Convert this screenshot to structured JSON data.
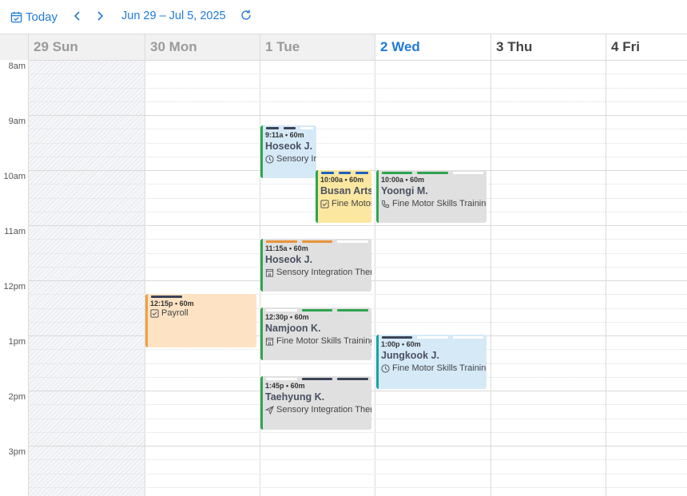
{
  "toolbar": {
    "today_label": "Today",
    "range_label": "Jun 29 – Jul 5, 2025",
    "icons": {
      "today": "calendar-check-icon",
      "prev": "chevron-left-icon",
      "next": "chevron-right-icon",
      "refresh": "refresh-icon"
    },
    "accent": "#1f7ad6"
  },
  "days": [
    {
      "num": "29",
      "name": "Sun",
      "state": "past"
    },
    {
      "num": "30",
      "name": "Mon",
      "state": "past"
    },
    {
      "num": "1",
      "name": "Tue",
      "state": "past"
    },
    {
      "num": "2",
      "name": "Wed",
      "state": "today"
    },
    {
      "num": "3",
      "name": "Thu",
      "state": "future"
    },
    {
      "num": "4",
      "name": "Fri",
      "state": "future"
    }
  ],
  "hours": [
    "8am",
    "9am",
    "10am",
    "11am",
    "12pm",
    "1pm",
    "2pm",
    "3pm"
  ],
  "events": [
    {
      "time": "9:11a • 60m",
      "title": "Hoseok J.",
      "subtitle": "Sensory Ir",
      "icon": "clock-icon",
      "bg": "#d5e9f7",
      "accent": "#2ea44f",
      "bars": [
        "#3b4358",
        "#3b4358",
        "#ffffff"
      ]
    },
    {
      "time": "10:00a • 60m",
      "title": "Busan Arts",
      "subtitle": "Fine Motor",
      "icon": "checkbox-icon",
      "bg": "#fbe7a0",
      "accent": "#2ea44f",
      "bars": [
        "#1f5fbf",
        "#1f5fbf",
        "#1f5fbf"
      ]
    },
    {
      "time": "10:00a • 60m",
      "title": "Yoongi M.",
      "subtitle": "Fine Motor Skills Training",
      "icon": "phone-icon",
      "bg": "#e0e0e0",
      "accent": "#2ea44f",
      "bars": [
        "#2ea44f",
        "#2ea44f",
        "#ffffff"
      ]
    },
    {
      "time": "11:15a • 60m",
      "title": "Hoseok J.",
      "subtitle": "Sensory Integration Ther",
      "icon": "building-icon",
      "bg": "#e0e0e0",
      "accent": "#2ea44f",
      "bars": [
        "#e8943a",
        "#e8943a",
        "#ffffff"
      ]
    },
    {
      "time": "12:15p • 60m",
      "title": "",
      "subtitle": "Payroll",
      "icon": "checkbox-icon",
      "bg": "#fde3c4",
      "accent": "#f0a040",
      "bars": [
        "#3b4358",
        "#fde3c4",
        "#fde3c4"
      ]
    },
    {
      "time": "12:30p • 60m",
      "title": "Namjoon K.",
      "subtitle": "Fine Motor Skills Training",
      "icon": "building-icon",
      "bg": "#e0e0e0",
      "accent": "#2ea44f",
      "bars": [
        "#ffffff",
        "#2ea44f",
        "#2ea44f"
      ]
    },
    {
      "time": "1:00p • 60m",
      "title": "Jungkook J.",
      "subtitle": "Fine Motor Skills Training",
      "icon": "clock-icon",
      "bg": "#d5e9f7",
      "accent": "#14a3a3",
      "bars": [
        "#3b4358",
        "#ffffff",
        "#ffffff"
      ]
    },
    {
      "time": "1:45p • 60m",
      "title": "Taehyung K.",
      "subtitle": "Sensory Integration Ther",
      "icon": "send-icon",
      "bg": "#e0e0e0",
      "accent": "#2ea44f",
      "bars": [
        "#ffffff",
        "#3b4358",
        "#3b4358"
      ]
    }
  ]
}
